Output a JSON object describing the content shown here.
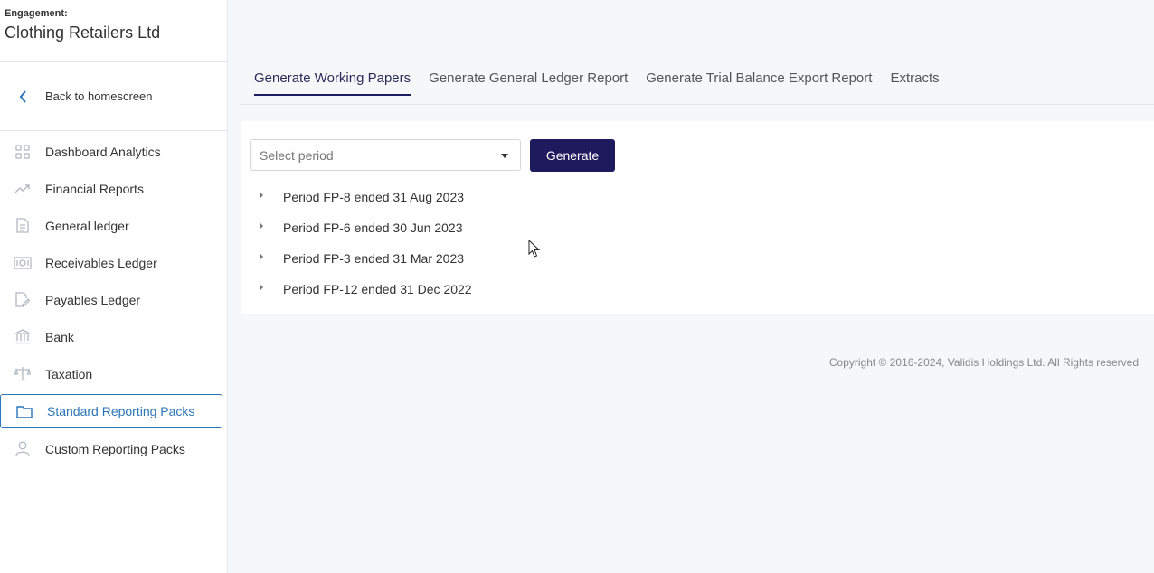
{
  "sidebar": {
    "engagement_label": "Engagement:",
    "engagement_name": "Clothing Retailers Ltd",
    "back_label": "Back to homescreen",
    "items": [
      {
        "label": "Dashboard Analytics",
        "icon": "grid-icon"
      },
      {
        "label": "Financial Reports",
        "icon": "trend-icon"
      },
      {
        "label": "General ledger",
        "icon": "document-icon"
      },
      {
        "label": "Receivables Ledger",
        "icon": "money-icon"
      },
      {
        "label": "Payables Ledger",
        "icon": "edit-document-icon"
      },
      {
        "label": "Bank",
        "icon": "bank-icon"
      },
      {
        "label": "Taxation",
        "icon": "scales-icon"
      },
      {
        "label": "Standard Reporting Packs",
        "icon": "folder-icon",
        "active": true
      },
      {
        "label": "Custom Reporting Packs",
        "icon": "user-icon"
      }
    ]
  },
  "tabs": [
    {
      "label": "Generate Working Papers",
      "active": true
    },
    {
      "label": "Generate General Ledger Report"
    },
    {
      "label": "Generate Trial Balance Export Report"
    },
    {
      "label": "Extracts"
    }
  ],
  "period_select": {
    "placeholder": "Select period"
  },
  "generate_label": "Generate",
  "periods": [
    "Period FP-8 ended 31 Aug 2023",
    "Period FP-6 ended 30 Jun 2023",
    "Period FP-3 ended 31 Mar 2023",
    "Period FP-12 ended 31 Dec 2022"
  ],
  "copyright": "Copyright © 2016-2024, Validis Holdings Ltd. All Rights reserved",
  "colors": {
    "accent": "#1f1a5e",
    "active_nav": "#2a74b8",
    "icon_gray": "#b4b9c2"
  }
}
